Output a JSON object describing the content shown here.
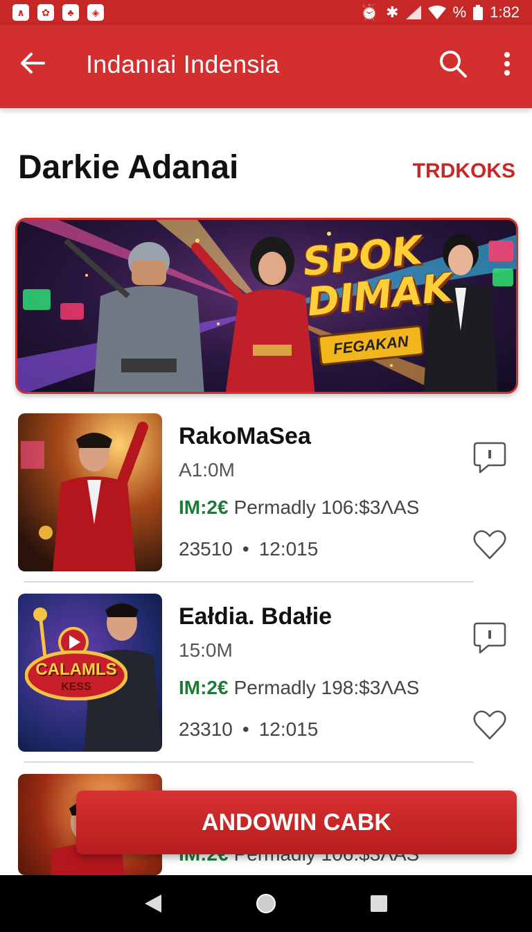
{
  "status_bar": {
    "time": "1:82",
    "battery": "%"
  },
  "app_bar": {
    "title": "Indanıai Indensia"
  },
  "section": {
    "title": "Darkie Adanai",
    "link": "TRDKOKS"
  },
  "banner": {
    "headline_line1": "SPOK",
    "headline_line2": "DIMAK",
    "tag": "FEGAKAN"
  },
  "items": [
    {
      "title": "RakoMaSea",
      "size": "A1:0M",
      "price": "IM:2€",
      "price_desc": "Permadly 106:$3ΛAS",
      "stat1": "23510",
      "separator": "•",
      "stat2": "12:015"
    },
    {
      "title": "Eałdia. Bdałie",
      "size": "15:0M",
      "price": "IM:2€",
      "price_desc": "Permadly 198:$3ΛAS",
      "stat1": "23310",
      "separator": "•",
      "stat2": "12:015",
      "thumb_badge": "CALAMLS",
      "thumb_badge_sub": "KESS"
    },
    {
      "price": "IM:2€",
      "price_desc": "Permadly 106:$3ΛAS"
    }
  ],
  "cta": {
    "label": "ANDOWIN CABK"
  },
  "colors": {
    "primary": "#d32f2f",
    "status_bar": "#c62828",
    "price_green": "#1f7a3a",
    "headline_gold": "#ffcf3a"
  }
}
